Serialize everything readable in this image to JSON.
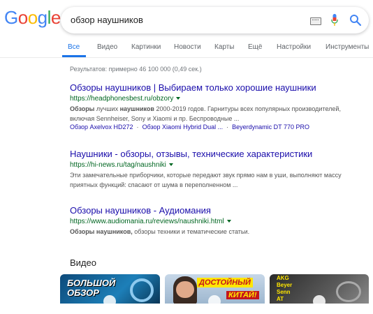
{
  "logo": {
    "text": "Google",
    "letters": [
      "G",
      "o",
      "o",
      "g",
      "l",
      "e"
    ],
    "colors": [
      "#4285F4",
      "#EA4335",
      "#FBBC05",
      "#4285F4",
      "#34A853",
      "#EA4335"
    ]
  },
  "search": {
    "query": "обзор наушников"
  },
  "tabs": [
    {
      "label": "Все",
      "active": true
    },
    {
      "label": "Видео"
    },
    {
      "label": "Картинки"
    },
    {
      "label": "Новости"
    },
    {
      "label": "Карты"
    },
    {
      "label": "Ещё"
    },
    {
      "label": "Настройки"
    },
    {
      "label": "Инструменты"
    }
  ],
  "stats": "Результатов: примерно 46 100 000 (0,49 сек.)",
  "results": [
    {
      "title": "Обзоры наушников | Выбираем только хорошие наушники",
      "url": "https://headphonesbest.ru/obzory",
      "snippet": "Обзоры лучших наушников 2000-2019 годов. Гарнитуры всех популярных производителей, включая Sennheiser, Sony и Xiaomi и пр. Беспроводные ...",
      "sitelinks": [
        "Обзор Axelvox HD272",
        "Обзор Xiaomi Hybrid Dual ...",
        "Beyerdynamic DT 770 PRO"
      ]
    },
    {
      "title": "Наушники - обзоры, отзывы, технические характеристики",
      "url": "https://hi-news.ru/tag/naushniki",
      "snippet": "Эти замечательные приборчики, которые передают звук прямо нам в уши, выполняют массу приятных функций: спасают от шума в переполненном ..."
    },
    {
      "title": "Обзоры наушников - Аудиомания",
      "url": "https://www.audiomania.ru/reviews/naushniki.html",
      "snippet": "Обзоры наушников, обзоры техники и тематические статьи."
    }
  ],
  "videos": {
    "heading": "Видео",
    "items": [
      {
        "overlay": "БОЛЬШОЙ ОБЗОР"
      },
      {
        "overlay_line1": "ДОСТОЙНЫЙ",
        "overlay_line2": "КИТАЙ!"
      },
      {
        "overlay_line1": "AKG",
        "overlay_line2": "Beyer",
        "overlay_line3": "Senn",
        "overlay_line4": "AT"
      }
    ]
  }
}
